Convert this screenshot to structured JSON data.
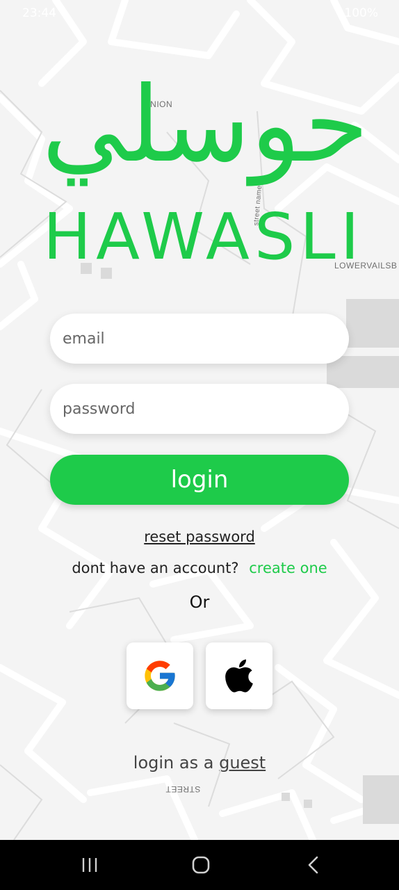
{
  "status_bar": {
    "time": "23:44",
    "right_text": "100%"
  },
  "map_labels": {
    "union": "UNION",
    "lowervails": "LOWERVAILSB",
    "street_name": "street name",
    "street": "STREET"
  },
  "logo": {
    "arabic": "حوسلي",
    "latin": "HAWASLI",
    "color": "#1ecb4a"
  },
  "form": {
    "email_placeholder": "email",
    "password_placeholder": "password",
    "login_label": "login"
  },
  "links": {
    "reset_password": "reset password",
    "no_account": "dont have an account?",
    "create_one": "create one",
    "or": "Or",
    "login_as": "login as a",
    "guest": "guest"
  },
  "social": {
    "google_icon": "google-icon",
    "apple_icon": "apple-icon"
  },
  "nav": {
    "recents_icon": "recents-icon",
    "home_icon": "home-icon",
    "back_icon": "back-icon"
  }
}
